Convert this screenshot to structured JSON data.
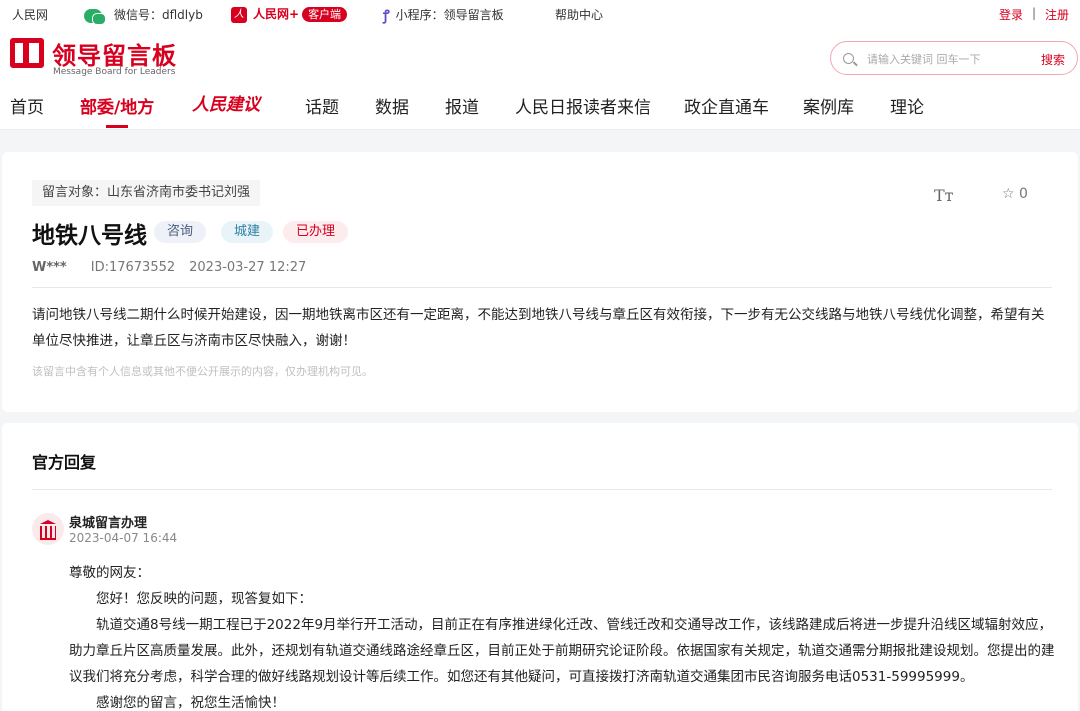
{
  "topbar": {
    "site": "人民网",
    "wechat_label": "微信号：dfldlyb",
    "rmw_label": "人民网+",
    "client_label": "客户端",
    "mini_label": "小程序：领导留言板",
    "help": "帮助中心",
    "login": "登录",
    "separator": "|",
    "register": "注册"
  },
  "header": {
    "logo_title": "领导留言板",
    "logo_sub": "Message Board for Leaders",
    "search_placeholder": "请输入关键词 回车一下",
    "search_button": "搜索"
  },
  "nav": {
    "items": [
      "首页",
      "部委/地方",
      "人民建议",
      "话题",
      "数据",
      "报道",
      "人民日报读者来信",
      "政企直通车",
      "案例库",
      "理论"
    ],
    "active_index": 1
  },
  "message": {
    "target": "留言对象：山东省济南市委书记刘强",
    "title": "地铁八号线",
    "tags": [
      "咨询",
      "城建",
      "已办理"
    ],
    "author": "W***",
    "id": "ID:17673552",
    "time": "2023-03-27 12:27",
    "favorite_count": "0",
    "font_icon_label": "Tт",
    "body": "请问地铁八号线二期什么时候开始建设，因一期地铁离市区还有一定距离，不能达到地铁八号线与章丘区有效衔接，下一步有无公交线路与地铁八号线优化调整，希望有关单位尽快推进，让章丘区与济南市区尽快融入，谢谢！",
    "note": "该留言中含有个人信息或其他不便公开展示的内容，仅办理机构可见。"
  },
  "reply": {
    "heading": "官方回复",
    "org": "泉城留言办理",
    "time": "2023-04-07 16:44",
    "greeting": "尊敬的网友：",
    "para1": "您好！您反映的问题，现答复如下：",
    "para2": "轨道交通8号线一期工程已于2022年9月举行开工活动，目前正在有序推进绿化迁改、管线迁改和交通导改工作，该线路建成后将进一步提升沿线区域辐射效应，助力章丘片区高质量发展。此外，还规划有轨道交通线路途经章丘区，目前正处于前期研究论证阶段。依据国家有关规定，轨道交通需分期报批建设规划。您提出的建议我们将充分考虑，科学合理的做好线路规划设计等后续工作。如您还有其他疑问，可直接拨打济南轨道交通集团市民咨询服务电话0531-59995999。",
    "para3": "感谢您的留言，祝您生活愉快！"
  },
  "colors": {
    "brand": "#d7001f",
    "tag_consult": "#4a5a80",
    "tag_urban": "#2f7fa5",
    "tag_done": "#d7001f"
  }
}
